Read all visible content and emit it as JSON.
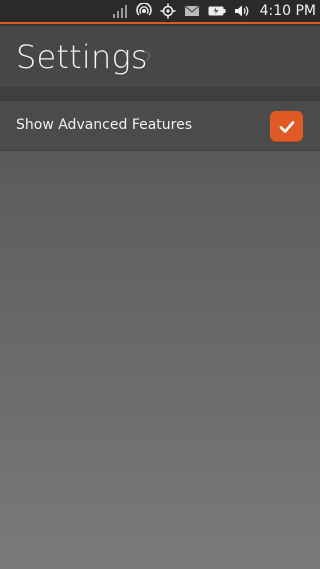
{
  "status_bar": {
    "icons": [
      "signal-icon",
      "hotspot-icon",
      "location-icon",
      "mail-icon",
      "battery-icon",
      "volume-icon"
    ],
    "time": "4:10 PM"
  },
  "header": {
    "title": "Settings"
  },
  "settings": {
    "items": [
      {
        "label": "Show Advanced Features",
        "checked": true
      }
    ]
  },
  "colors": {
    "accent": "#e05a26"
  }
}
